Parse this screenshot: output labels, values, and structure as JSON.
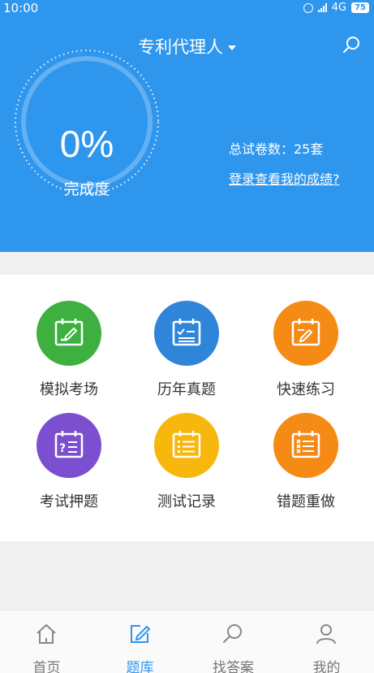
{
  "status": {
    "time": "10:00",
    "network": "4G",
    "battery": "75"
  },
  "header": {
    "title": "专利代理人"
  },
  "progress": {
    "percent_text": "0%",
    "percent": 0,
    "label": "完成度"
  },
  "summary": {
    "total_papers": "总试卷数：25套",
    "login_link": "登录查看我的成绩?"
  },
  "tiles": [
    {
      "label": "模拟考场",
      "color": "#3db03f",
      "icon": "exam-icon"
    },
    {
      "label": "历年真题",
      "color": "#2f86d8",
      "icon": "checklist-icon"
    },
    {
      "label": "快速练习",
      "color": "#f58a14",
      "icon": "practice-icon"
    },
    {
      "label": "考试押题",
      "color": "#7c4fd0",
      "icon": "question-icon"
    },
    {
      "label": "测试记录",
      "color": "#f7b70c",
      "icon": "record-icon"
    },
    {
      "label": "错题重做",
      "color": "#f58a14",
      "icon": "wrong-answer-icon"
    }
  ],
  "tabs": [
    {
      "label": "首页",
      "icon": "home-icon"
    },
    {
      "label": "题库",
      "icon": "edit-icon",
      "active": true
    },
    {
      "label": "找答案",
      "icon": "search-icon"
    },
    {
      "label": "我的",
      "icon": "user-icon"
    }
  ]
}
